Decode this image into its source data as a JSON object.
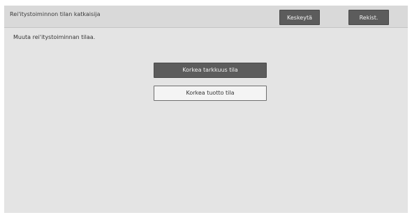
{
  "header": {
    "title": "Rei'itystoiminnon tilan katkaisija",
    "cancel_label": "Keskeytä",
    "register_label": "Rekist."
  },
  "main": {
    "instruction": "Muuta rei'itystoiminnan tilaa.",
    "modes": [
      {
        "label": "Korkea tarkkuus tila",
        "selected": true
      },
      {
        "label": "Korkea tuotto tila",
        "selected": false
      }
    ]
  },
  "colors": {
    "panel_background": "#e4e4e4",
    "header_background": "#d9d9d9",
    "button_dark": "#5c5c5c",
    "button_light": "#f4f4f4"
  }
}
